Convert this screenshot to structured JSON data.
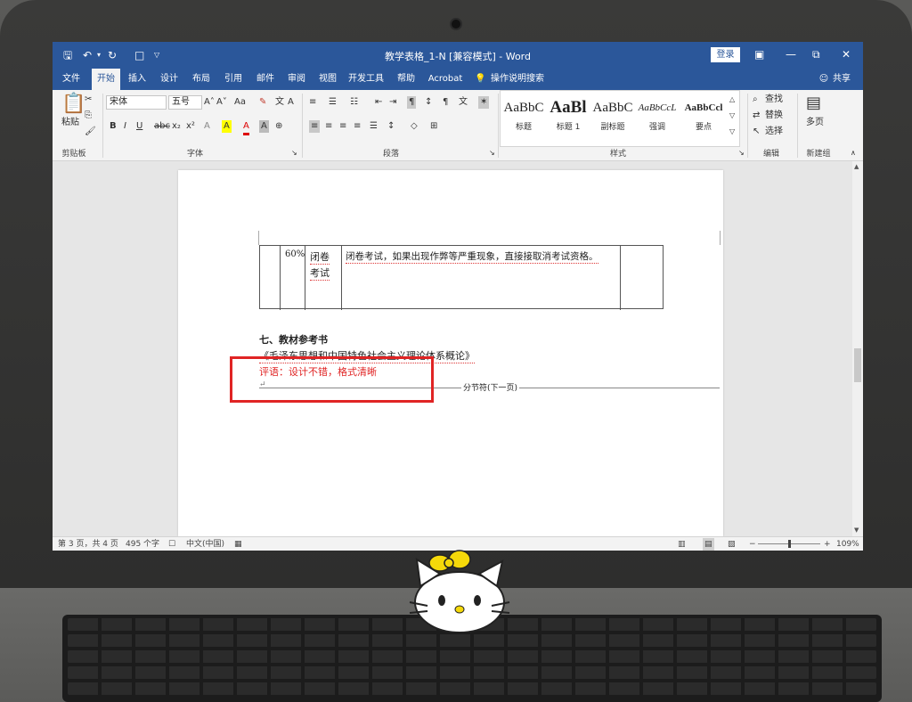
{
  "window": {
    "title": "教学表格_1-N [兼容模式] - Word",
    "login": "登录",
    "share": "共享"
  },
  "menu": {
    "tabs": [
      "文件",
      "开始",
      "插入",
      "设计",
      "布局",
      "引用",
      "邮件",
      "审阅",
      "视图",
      "开发工具",
      "帮助",
      "Acrobat",
      "操作说明搜索"
    ],
    "active": "开始"
  },
  "ribbon": {
    "clipboard": {
      "paste": "粘贴",
      "label": "剪贴板"
    },
    "font": {
      "name": "宋体",
      "size": "五号",
      "grow": "A˄",
      "shrink": "A˅",
      "case": "Aa",
      "label": "字体",
      "buttons": [
        "B",
        "I",
        "U",
        "abc",
        "x₂",
        "x²",
        "A",
        "A",
        "A"
      ]
    },
    "paragraph": {
      "label": "段落"
    },
    "styles": {
      "items": [
        {
          "sample": "AaBbC",
          "label": "标题"
        },
        {
          "sample": "AaBl",
          "label": "标题 1"
        },
        {
          "sample": "AaBbC",
          "label": "副标题"
        },
        {
          "sample": "AaBbCcL",
          "label": "强调"
        },
        {
          "sample": "AaBbCcl",
          "label": "要点"
        }
      ],
      "label": "样式"
    },
    "editing": {
      "find": "查找",
      "replace": "替换",
      "select": "选择",
      "label": "编辑"
    },
    "newgroup": {
      "multipage": "多页",
      "label": "新建组"
    }
  },
  "document": {
    "table": {
      "percent": "60%",
      "method": "闭卷考试",
      "method_line1": "闭卷",
      "method_line2": "考试",
      "description": "闭卷考试，如果出现作弊等严重现象，直接接取消考试资格。"
    },
    "section_heading": "七、教材参考书",
    "reference": "《毛泽东思想和中国特色社会主义理论体系概论》",
    "comment": "评语：设计不错，格式清晰",
    "section_break": "分节符(下一页)"
  },
  "statusbar": {
    "page": "第 3 页，共 4 页",
    "words": "495 个字",
    "language": "中文(中国)",
    "zoom": "109%"
  },
  "colors": {
    "titlebar": "#2b579a",
    "comment_text": "#e02424",
    "annotation_box": "#e02424"
  }
}
